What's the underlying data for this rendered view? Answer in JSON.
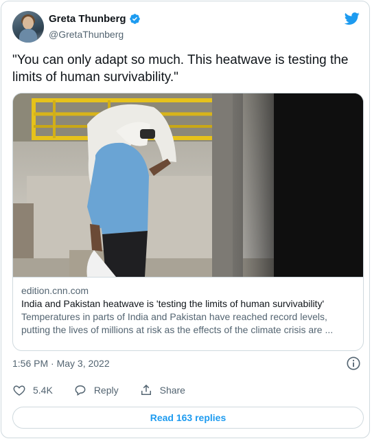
{
  "author": {
    "name": "Greta Thunberg",
    "handle": "@GretaThunberg"
  },
  "tweet": {
    "text": "\"You can only adapt so much. This heatwave is testing the limits of human survivability.\""
  },
  "card": {
    "domain": "edition.cnn.com",
    "title": "India and Pakistan heatwave is 'testing the limits of human survivability'",
    "description": "Temperatures in parts of India and Pakistan have reached record levels, putting the lives of millions at risk as the effects of the climate crisis are ..."
  },
  "meta": {
    "timestamp": "1:56 PM · May 3, 2022"
  },
  "actions": {
    "like_count": "5.4K",
    "reply_label": "Reply",
    "share_label": "Share"
  },
  "footer": {
    "read_replies_label": "Read 163 replies"
  },
  "colors": {
    "accent": "#1d9bf0",
    "text": "#0f1419",
    "secondary": "#536471",
    "border": "#cfd9de"
  },
  "icons": {
    "verified": "verified-badge-icon",
    "brand": "twitter-bird-icon",
    "info": "info-icon",
    "like": "heart-icon",
    "reply": "speech-bubble-icon",
    "share": "share-upload-icon"
  }
}
